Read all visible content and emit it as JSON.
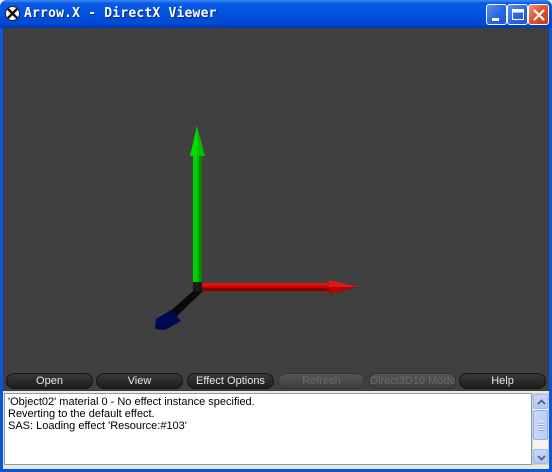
{
  "window": {
    "title": "Arrow.X - DirectX Viewer",
    "icon": "directx-icon",
    "controls": [
      "minimize-icon",
      "maximize-icon",
      "close-icon"
    ]
  },
  "viewport": {
    "background_color": "#404040",
    "axes": [
      {
        "name": "y-axis",
        "color": "#00cc00"
      },
      {
        "name": "x-axis",
        "color": "#cc0000"
      },
      {
        "name": "z-axis",
        "color": "#000060"
      }
    ]
  },
  "toolbar": {
    "buttons": [
      {
        "label": "Open",
        "enabled": true
      },
      {
        "label": "View",
        "enabled": true
      },
      {
        "label": "Effect Options",
        "enabled": true
      },
      {
        "label": "Refresh",
        "enabled": false
      },
      {
        "label": "Direct3D10 Mode",
        "enabled": false
      },
      {
        "label": "Help",
        "enabled": true
      }
    ]
  },
  "log": {
    "lines": [
      "'Object02' material 0 - No effect instance specified.",
      "Reverting to the default effect.",
      "SAS: Loading effect 'Resource:#103'"
    ]
  }
}
